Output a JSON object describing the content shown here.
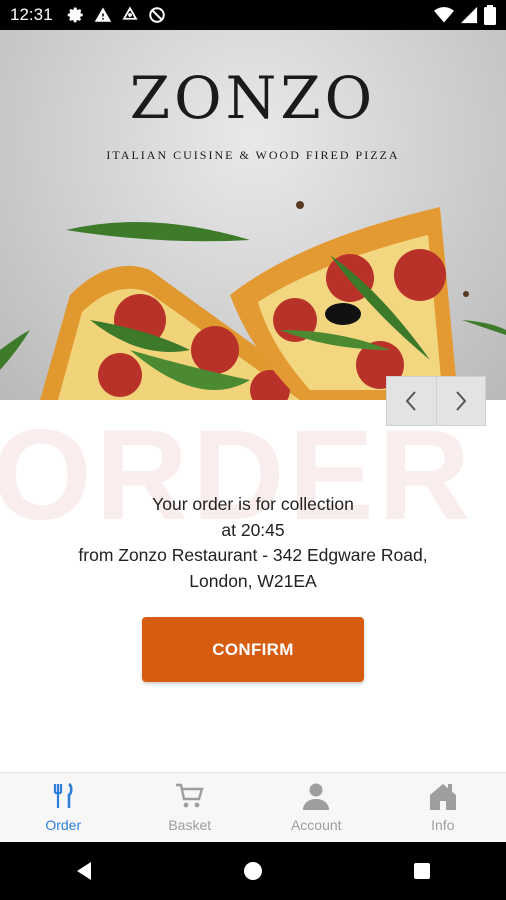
{
  "status_bar": {
    "time": "12:31"
  },
  "hero": {
    "logo_title": "ZONZO",
    "logo_subtitle": "ITALIAN CUISINE & WOOD FIRED PIZZA"
  },
  "watermark": "ORDER",
  "order": {
    "line1": "Your order is for collection",
    "line2": "at 20:45",
    "line3": "from Zonzo Restaurant - 342 Edgware Road,",
    "line4": "London, W21EA"
  },
  "confirm_label": "CONFIRM",
  "tabs": [
    {
      "label": "Order",
      "icon": "fork-knife-icon",
      "active": true
    },
    {
      "label": "Basket",
      "icon": "cart-icon",
      "active": false
    },
    {
      "label": "Account",
      "icon": "person-icon",
      "active": false
    },
    {
      "label": "Info",
      "icon": "home-icon",
      "active": false
    }
  ],
  "colors": {
    "accent": "#d65c10",
    "tab_active": "#2f7fd8",
    "tab_inactive": "#9e9e9e"
  }
}
